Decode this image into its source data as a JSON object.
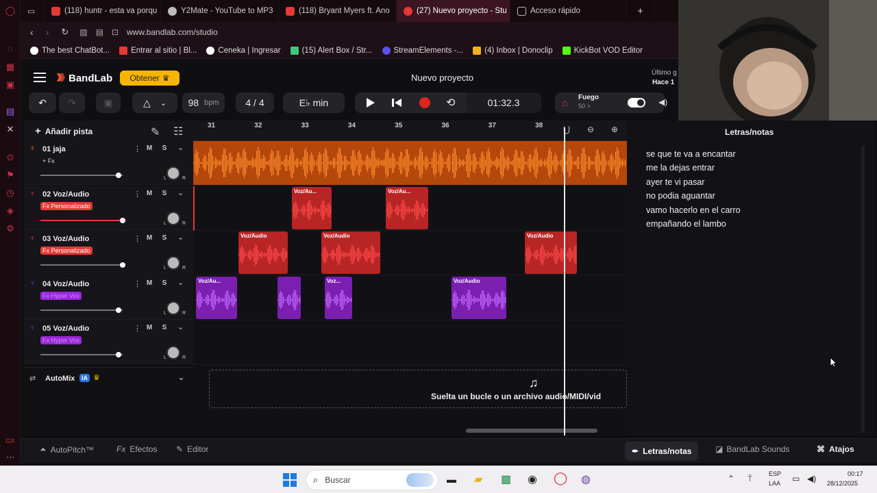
{
  "browser": {
    "tabs": [
      {
        "label": "(118) huntr - esta va porqu",
        "color": "#e53935",
        "active": false
      },
      {
        "label": "Y2Mate - YouTube to MP3",
        "color": "#bbbbbb",
        "active": false
      },
      {
        "label": "(118) Bryant Myers ft. Ano",
        "color": "#e53935",
        "active": false
      },
      {
        "label": "(27) Nuevo proyecto - Stu",
        "color": "#e53935",
        "active": true
      },
      {
        "label": "Acceso rápido",
        "color": "#bbbbbb",
        "active": false
      }
    ],
    "new_tab": "+",
    "url": "www.bandlab.com/studio",
    "bookmarks": [
      {
        "label": "The best ChatBot...",
        "color": "#ffffff"
      },
      {
        "label": "Entrar al sitio | Bl...",
        "color": "#e53935"
      },
      {
        "label": "Ceneka | Ingresar",
        "color": "#ffffff"
      },
      {
        "label": "(15) Alert Box / Str...",
        "color": "#3ec77b"
      },
      {
        "label": "StreamElements -...",
        "color": "#5a4ff0"
      },
      {
        "label": "(4) Inbox | Donoclip",
        "color": "#f2b01e"
      },
      {
        "label": "KickBot VOD Editor",
        "color": "#53fc18"
      }
    ]
  },
  "header": {
    "logo": "BandLab",
    "get_button": "Obtener",
    "project_title": "Nuevo proyecto",
    "last_saved_label": "Último g",
    "last_saved_value": "Hace 1"
  },
  "transport": {
    "bpm_value": "98",
    "bpm_unit": "bpm",
    "time_signature": "4 / 4",
    "key": "E♭ min",
    "position": "01:32.3",
    "fuego_label": "Fuego",
    "fuego_sub": "50 >"
  },
  "timeline": {
    "add_track": "Añadir pista",
    "bars": [
      "31",
      "32",
      "33",
      "34",
      "35",
      "36",
      "37",
      "38"
    ]
  },
  "tracks": [
    {
      "number": "01",
      "name": "jaja",
      "fx": "+ Fx",
      "fx_color": "#bbbbbb",
      "color": "#ff6a13",
      "volume": 0.8
    },
    {
      "number": "02",
      "name": "Voz/Audio",
      "fx": "Fx Personalizado",
      "fx_color": "#e53935",
      "color": "#e33a3a",
      "volume": 1.0
    },
    {
      "number": "03",
      "name": "Voz/Audio",
      "fx": "Fx Personalizado",
      "fx_color": "#e53935",
      "color": "#e33a3a",
      "volume": 1.0
    },
    {
      "number": "04",
      "name": "Voz/Audio",
      "fx": "Fx Hyper Vox",
      "fx_color": "#9b27d9",
      "color": "#9b27d9",
      "volume": 0.8
    },
    {
      "number": "05",
      "name": "Voz/Audio",
      "fx": "Fx Hyper Vox",
      "fx_color": "#9b27d9",
      "color": "#9b27d9",
      "volume": 0.8
    }
  ],
  "track_buttons": {
    "mute": "M",
    "solo": "S",
    "pan_l": "L",
    "pan_r": "R"
  },
  "clips": {
    "track2": [
      "Voz/Au...",
      "Voz/Au..."
    ],
    "track3": [
      "Voz/Audio",
      "Voz/Audio",
      "Voz/Audio"
    ],
    "track4": [
      "Voz/Au...",
      "Voz...",
      "Voz/Audio"
    ]
  },
  "automix": {
    "label": "AutoMix",
    "badge": "IA"
  },
  "drop_zone": "Suelta un bucle o un archivo audio/MIDI/vid",
  "notes": {
    "title": "Letras/notas",
    "lines": [
      "se que te va a encantar",
      "me la dejas  entrar",
      "ayer te vi pasar",
      "no podia aguantar",
      "vamo hacerlo en el carro",
      "empañando el lambo"
    ]
  },
  "bottom_bar": {
    "autopitch": "AutoPitch™",
    "effects": "Efectos",
    "editor": "Editor",
    "lyrics_notes": "Letras/notas",
    "sounds": "BandLab Sounds",
    "shortcuts": "Atajos"
  },
  "taskbar": {
    "search_placeholder": "Buscar",
    "lang_top": "ESP",
    "lang_bottom": "LAA",
    "time": "00:17",
    "date": "28/12/2025"
  }
}
